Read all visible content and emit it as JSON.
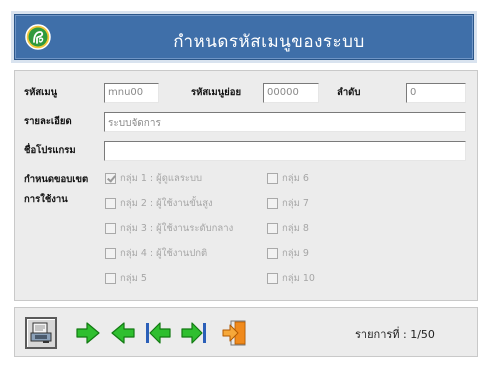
{
  "header": {
    "title": "กำหนดรหัสเมนูของระบบ"
  },
  "form": {
    "menu_code_label": "รหัสเมนู",
    "menu_code_value": "mnu00",
    "sub_code_label": "รหัสเมนูย่อย",
    "sub_code_value": "00000",
    "order_label": "ลำดับ",
    "order_value": "0",
    "detail_label": "รายละเอียด",
    "detail_value": "ระบบจัดการ",
    "program_label": "ชื่อโปรแกรม",
    "program_value": "",
    "scope_label_1": "กำหนดขอบเขต",
    "scope_label_2": "การใช้งาน",
    "groups": [
      {
        "label": "กลุ่ม 1 : ผู้ดูแลระบบ",
        "checked": true
      },
      {
        "label": "กลุ่ม 2 : ผู้ใช้งานขั้นสูง",
        "checked": false
      },
      {
        "label": "กลุ่ม 3 : ผู้ใช้งานระดับกลาง",
        "checked": false
      },
      {
        "label": "กลุ่ม 4 : ผู้ใช้งานปกติ",
        "checked": false
      },
      {
        "label": "กลุ่ม 5",
        "checked": false
      },
      {
        "label": "กลุ่ม 6",
        "checked": false
      },
      {
        "label": "กลุ่ม 7",
        "checked": false
      },
      {
        "label": "กลุ่ม 8",
        "checked": false
      },
      {
        "label": "กลุ่ม 9",
        "checked": false
      },
      {
        "label": "กลุ่ม 10",
        "checked": false
      }
    ]
  },
  "toolbar": {
    "buttons": [
      "save-icon",
      "next-icon",
      "previous-icon",
      "first-icon",
      "last-icon",
      "exit-icon"
    ],
    "record_label": "รายการที่ : 1/50"
  },
  "colors": {
    "header_bg": "#3f6fa9",
    "arrow_green": "#2fbf2f",
    "arrow_blue": "#2b5fb8",
    "exit_orange": "#f08a1c"
  }
}
